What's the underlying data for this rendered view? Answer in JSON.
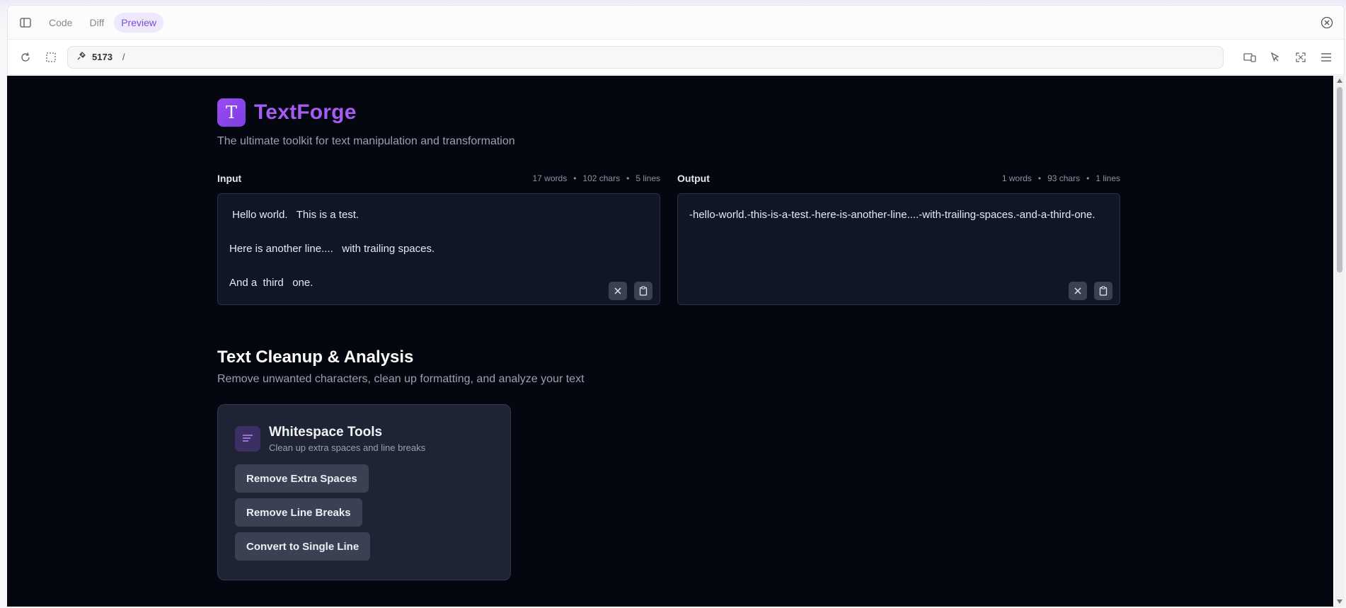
{
  "tabs": [
    {
      "label": "Code",
      "active": false
    },
    {
      "label": "Diff",
      "active": false
    },
    {
      "label": "Preview",
      "active": true
    }
  ],
  "address": {
    "port": "5173",
    "path": "/"
  },
  "app": {
    "name": "TextForge",
    "logo_letter": "T",
    "tagline": "The ultimate toolkit for text manipulation and transformation"
  },
  "input": {
    "title": "Input",
    "words": "17 words",
    "chars": "102 chars",
    "lines": "5 lines",
    "text_lines": [
      " Hello world.   This is a test.",
      "",
      "Here is another line....   with trailing spaces.",
      "",
      "And a  third   one."
    ]
  },
  "output": {
    "title": "Output",
    "words": "1 words",
    "chars": "93 chars",
    "lines": "1 lines",
    "text": "-hello-world.-this-is-a-test.-here-is-another-line....-with-trailing-spaces.-and-a-third-one."
  },
  "section": {
    "title": "Text Cleanup & Analysis",
    "subtitle": "Remove unwanted characters, clean up formatting, and analyze your text"
  },
  "card": {
    "title": "Whitespace Tools",
    "subtitle": "Clean up extra spaces and line breaks",
    "buttons": [
      "Remove Extra Spaces",
      "Remove Line Breaks",
      "Convert to Single Line"
    ]
  },
  "colors": {
    "accent": "#a55cf2",
    "background": "#04070f",
    "card": "#1e2433"
  }
}
